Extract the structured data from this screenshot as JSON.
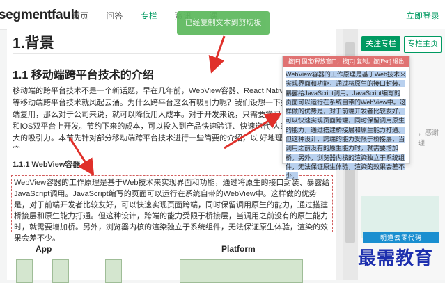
{
  "header": {
    "logo": "segmentfault",
    "nav": [
      "首页",
      "问答",
      "专栏",
      "资讯",
      "课"
    ],
    "register": "立即登录"
  },
  "article": {
    "h1": "1.背景",
    "h2": "1.1 移动端跨平台技术的介绍",
    "paragraph": "移动端的跨平台技术不是一个新话题，早在几年前，WebView容器、React Native、Weex 程序等移动端跨平台技术就风起云涌。为什么跨平台这么有吸引力呢？我们设想一下如果 开发，多端复用，那么对于公司来说，就可以降低用人成本。对于开发来说，只需要学习 可以在Android和iOS双平台上开发。节约下来的成本，可以投入到产品快速验证、快速迭代 人来说都有着极大的吸引力。本节先针对部分移动端跨平台技术进行一些简要的介绍，以 好地理解后面的内容。",
    "h3": "1.1.1 WebView容器",
    "selected_text": "WebView容器的工作原理是基于Web技术来实现界面和功能，通过将原生的接口封装、暴露给JavaScript调用。JavaScript编写的页面可以运行在系统自带的WebView中。这样做的优势是，对于前端开发者比较友好，可以快速实现页面跨端，同时保留调用原生的能力，通过搭建桥接层和原生能力打通。但这种设计，跨端的能力受限于桥接层，当调用之前没有的原生能力时，就需要增加桥。另外，浏览器内核的渲染独立于系统组件，无法保证原生体验，渲染的效果会差不少。",
    "diagram_left": "App",
    "diagram_right": "Platform"
  },
  "sidebar": {
    "follow_button": "关注专栏",
    "home_button": "专栏主页",
    "side_text": "，感谢理",
    "ad_banner": "明道云零代码"
  },
  "toast": "已经复制文本到剪切板",
  "popup": {
    "header": "按[F] 固定/释放窗口，按[C] 复制，按[Esc] 退出",
    "body": "WebView容器的工作原理是基于Web技术来实现界面和功能，通过将原生的接口封装、暴露给JavaScript调用。JavaScript编写的页面可以运行在系统自带的WebView中。这样做的优势是，对于前端开发者比较友好，可以快速实现页面跨端，同时保留调用原生的能力，通过搭建桥接层和原生能力打通。但这种设计，跨端的能力受限于桥接层，当调用之前没有的原生能力时，就需要增加桥。另外，浏览器内核的渲染独立于系统组件，无法保证原生体验，渲染的效果会差不少。"
  },
  "watermark": "最需教育",
  "colors": {
    "accent": "#009a61",
    "arrow": "#e0302a",
    "popup_head": "#e07272",
    "toast": "#5cb85c"
  }
}
